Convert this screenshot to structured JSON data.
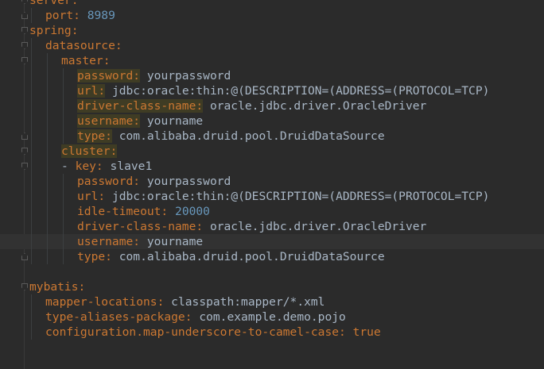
{
  "lines": [
    {
      "indent": 0,
      "key": "server:",
      "value": "",
      "fold": "down",
      "highlight": false
    },
    {
      "indent": 1,
      "key": "port:",
      "value": "8989",
      "valueType": "num",
      "fold": "up",
      "highlight": false
    },
    {
      "indent": 0,
      "key": "spring:",
      "value": "",
      "fold": "down",
      "highlight": false
    },
    {
      "indent": 1,
      "key": "datasource:",
      "value": "",
      "fold": "down",
      "highlight": false
    },
    {
      "indent": 2,
      "key": "master:",
      "value": "",
      "fold": "down",
      "highlight": false
    },
    {
      "indent": 3,
      "key": "password:",
      "value": "yourpassword",
      "fold": "",
      "highlight": true
    },
    {
      "indent": 3,
      "key": "url:",
      "value": "jdbc:oracle:thin:@(DESCRIPTION=(ADDRESS=(PROTOCOL=TCP)",
      "fold": "",
      "highlight": true
    },
    {
      "indent": 3,
      "key": "driver-class-name:",
      "value": "oracle.jdbc.driver.OracleDriver",
      "fold": "",
      "highlight": true
    },
    {
      "indent": 3,
      "key": "username:",
      "value": "yourname",
      "fold": "",
      "highlight": true
    },
    {
      "indent": 3,
      "key": "type:",
      "value": "com.alibaba.druid.pool.DruidDataSource",
      "fold": "up",
      "highlight": true
    },
    {
      "indent": 2,
      "key": "cluster:",
      "value": "",
      "fold": "down",
      "highlight": true
    },
    {
      "indent": 2,
      "key": "- key:",
      "value": "slave1",
      "fold": "down",
      "highlight": false
    },
    {
      "indent": 3,
      "key": "password:",
      "value": "yourpassword",
      "fold": "",
      "highlight": false
    },
    {
      "indent": 3,
      "key": "url:",
      "value": "jdbc:oracle:thin:@(DESCRIPTION=(ADDRESS=(PROTOCOL=TCP)",
      "fold": "",
      "highlight": false
    },
    {
      "indent": 3,
      "key": "idle-timeout:",
      "value": "20000",
      "valueType": "num",
      "fold": "",
      "highlight": false
    },
    {
      "indent": 3,
      "key": "driver-class-name:",
      "value": "oracle.jdbc.driver.OracleDriver",
      "fold": "",
      "highlight": false
    },
    {
      "indent": 3,
      "key": "username:",
      "value": "yourname",
      "fold": "",
      "highlight": false,
      "caret": true
    },
    {
      "indent": 3,
      "key": "type:",
      "value": "com.alibaba.druid.pool.DruidDataSource",
      "fold": "up",
      "highlight": false
    },
    {
      "indent": 0,
      "key": "",
      "value": "",
      "fold": "",
      "highlight": false
    },
    {
      "indent": 0,
      "key": "mybatis:",
      "value": "",
      "fold": "down",
      "highlight": false
    },
    {
      "indent": 1,
      "key": "mapper-locations:",
      "value": "classpath:mapper/*.xml",
      "fold": "",
      "highlight": false
    },
    {
      "indent": 1,
      "key": "type-aliases-package:",
      "value": "com.example.demo.pojo",
      "fold": "",
      "highlight": false
    },
    {
      "indent": 1,
      "key": "configuration.map-underscore-to-camel-case:",
      "value": "true",
      "valueType": "bool",
      "fold": "",
      "highlight": false
    }
  ]
}
